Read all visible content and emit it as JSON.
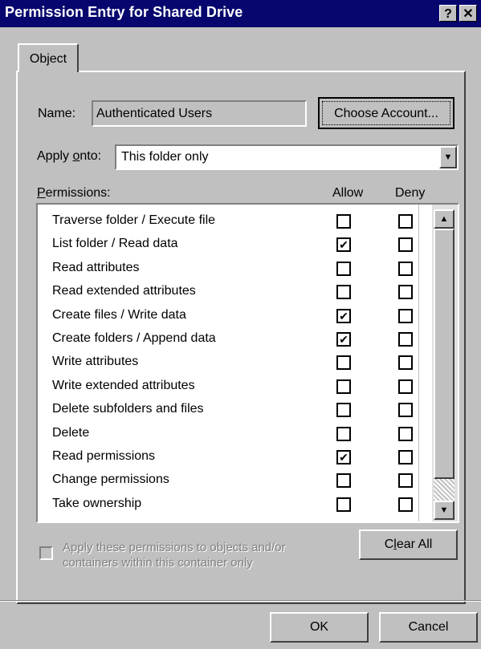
{
  "window": {
    "title": "Permission Entry for Shared Drive",
    "help_label": "?",
    "close_label": "✕"
  },
  "tab": {
    "label": "Object"
  },
  "name_field": {
    "label": "Name:",
    "value": "Authenticated Users"
  },
  "choose_account": {
    "label": "Choose Account..."
  },
  "apply_onto": {
    "label": "Apply onto:",
    "value": "This folder only"
  },
  "permissions": {
    "label": "Permissions:",
    "col_allow": "Allow",
    "col_deny": "Deny",
    "rows": [
      {
        "name": "Traverse folder / Execute file",
        "allow": false,
        "deny": false
      },
      {
        "name": "List folder / Read data",
        "allow": true,
        "deny": false
      },
      {
        "name": "Read attributes",
        "allow": false,
        "deny": false
      },
      {
        "name": "Read extended attributes",
        "allow": false,
        "deny": false
      },
      {
        "name": "Create files / Write data",
        "allow": true,
        "deny": false
      },
      {
        "name": "Create folders / Append data",
        "allow": true,
        "deny": false
      },
      {
        "name": "Write attributes",
        "allow": false,
        "deny": false
      },
      {
        "name": "Write extended attributes",
        "allow": false,
        "deny": false
      },
      {
        "name": "Delete subfolders and files",
        "allow": false,
        "deny": false
      },
      {
        "name": "Delete",
        "allow": false,
        "deny": false
      },
      {
        "name": "Read permissions",
        "allow": true,
        "deny": false
      },
      {
        "name": "Change permissions",
        "allow": false,
        "deny": false
      },
      {
        "name": "Take ownership",
        "allow": false,
        "deny": false
      }
    ]
  },
  "apply_children": {
    "line1": "Apply these permissions to objects and/or",
    "line2": "containers within this container only",
    "checked": false
  },
  "clear_all": {
    "label": "Clear All"
  },
  "ok": {
    "label": "OK"
  },
  "cancel": {
    "label": "Cancel"
  },
  "glyphs": {
    "check": "✔",
    "scroll_up": "▲",
    "scroll_down": "▼",
    "dropdown": "▼"
  }
}
